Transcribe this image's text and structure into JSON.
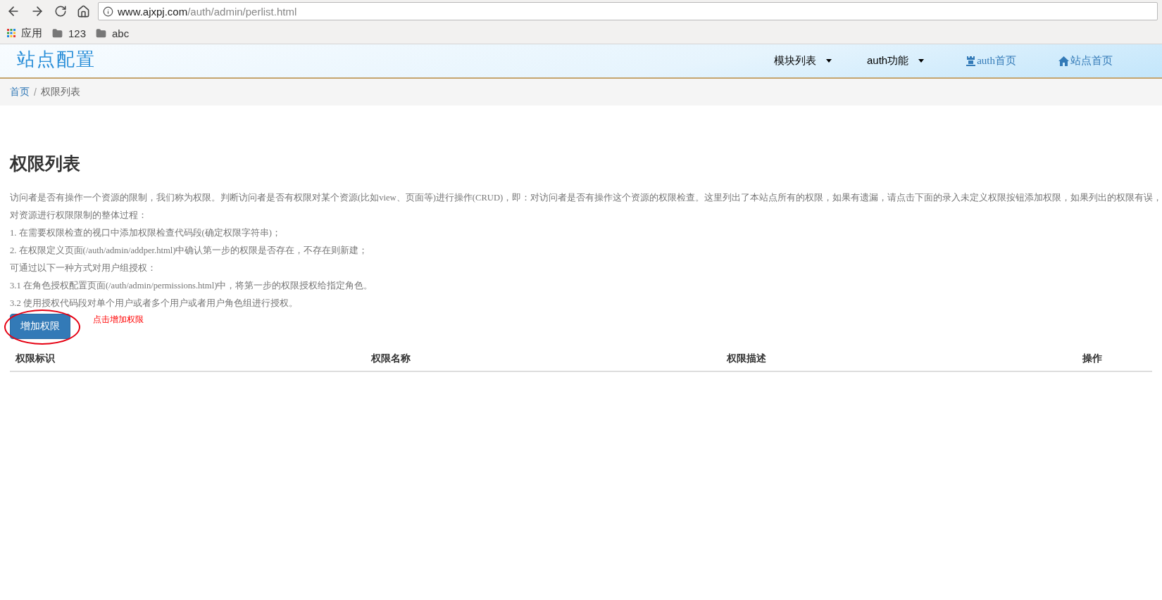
{
  "browser": {
    "url_host": "www.ajxpj.com",
    "url_path": "/auth/admin/perlist.html",
    "bookmarks": [
      {
        "kind": "apps",
        "label": "应用"
      },
      {
        "kind": "folder",
        "label": "123"
      },
      {
        "kind": "folder",
        "label": "abc"
      }
    ]
  },
  "header": {
    "site_title": "站点配置",
    "nav": [
      {
        "kind": "dropdown",
        "label": "模块列表"
      },
      {
        "kind": "dropdown",
        "label": "auth功能"
      },
      {
        "kind": "rook-link",
        "label": "auth首页"
      },
      {
        "kind": "home-link",
        "label": "站点首页"
      }
    ]
  },
  "breadcrumb": [
    {
      "label": "首页",
      "selected": false
    },
    {
      "label": "权限列表",
      "selected": true,
      "separator": "/"
    }
  ],
  "page": {
    "title": "权限列表",
    "description": [
      "访问者是否有操作一个资源的限制，我们称为权限。判断访问者是否有权限对某个资源(比如view、页面等)进行操作(CRUD)，即：对访问者是否有操作这个资源的权限检查。这里列出了本站点所有的权限，如果有遗漏，请点击下面的录入未定义权限按钮添加权限，如果列出的权限有误，",
      "对资源进行权限限制的整体过程：",
      "1. 在需要权限检查的视口中添加权限检查代码段(确定权限字符串)；",
      "2. 在权限定义页面(/auth/admin/addper.html)中确认第一步的权限是否存在，不存在则新建；",
      "可通过以下一种方式对用户组授权：",
      "3.1 在角色授权配置页面(/auth/admin/permissions.html)中，将第一步的权限授权给指定角色。",
      "3.2 使用授权代码段对单个用户或者多个用户或者用户角色组进行授权。"
    ],
    "add_button": "增加权限",
    "annotation": "点击增加权限"
  },
  "table": {
    "columns": [
      "权限标识",
      "权限名称",
      "权限描述",
      "操作"
    ]
  }
}
